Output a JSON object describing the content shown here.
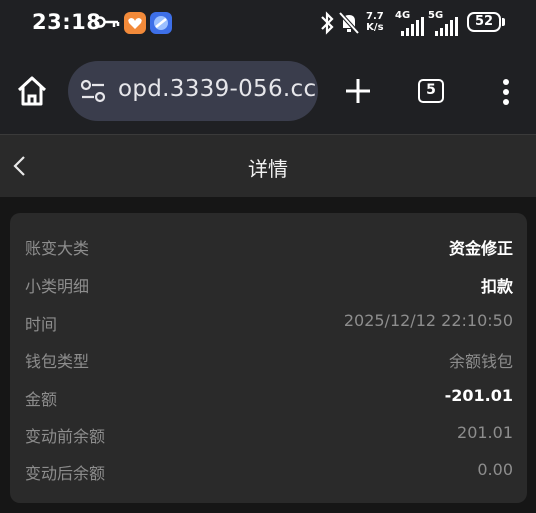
{
  "status_bar": {
    "time": "23:18",
    "net_speed_top": "7.7",
    "net_speed_bottom": "K/s",
    "sim1": "4G",
    "sim2": "5G",
    "battery": "52",
    "icons": [
      "key-icon",
      "app-icon",
      "app-icon",
      "bluetooth-icon",
      "mute-bell-icon",
      "signal-icon",
      "signal-icon"
    ]
  },
  "browser": {
    "url": "opd.3339-056.cc",
    "tab_count": "5",
    "icons": [
      "home-icon",
      "site-settings-icon",
      "plus-icon",
      "tabs-icon",
      "more-vert-icon"
    ]
  },
  "header": {
    "title": "详情",
    "back_icon": "chevron-left-icon"
  },
  "details": [
    {
      "label": "账变大类",
      "value": "资金修正",
      "emphasis": true
    },
    {
      "label": "小类明细",
      "value": "扣款",
      "emphasis": true
    },
    {
      "label": "时间",
      "value": "2025/12/12 22:10:50",
      "emphasis": false
    },
    {
      "label": "钱包类型",
      "value": "余额钱包",
      "emphasis": false
    },
    {
      "label": "金额",
      "value": "-201.01",
      "emphasis": true
    },
    {
      "label": "变动前余额",
      "value": "201.01",
      "emphasis": false
    },
    {
      "label": "变动后余额",
      "value": "0.00",
      "emphasis": false
    }
  ],
  "colors": {
    "background": "#161616",
    "toolbar": "#1f2023",
    "urlbar": "#3a3d4c",
    "card": "#2a2a2a",
    "label": "#8d8d8d",
    "value_emphasis": "#ffffff"
  }
}
